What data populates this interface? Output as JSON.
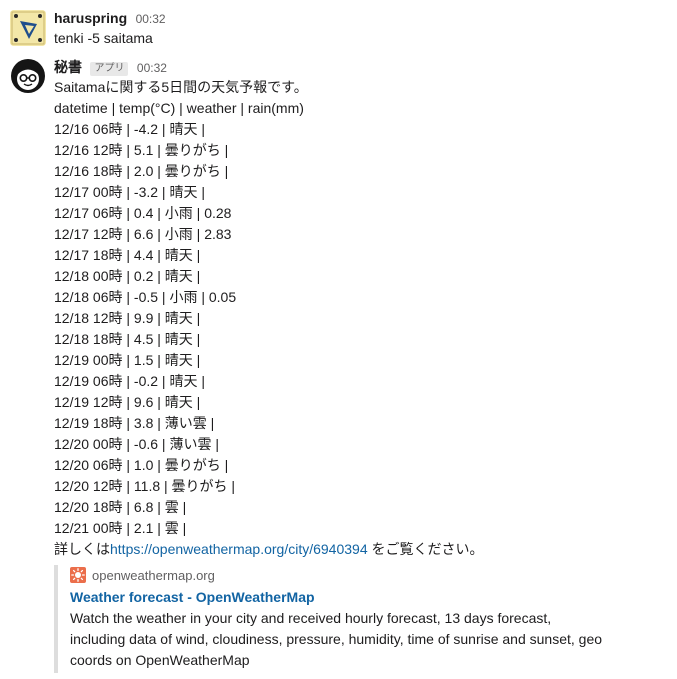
{
  "messages": [
    {
      "user": "haruspring",
      "time": "00:32",
      "lines": [
        "tenki -5 saitama"
      ]
    },
    {
      "user": "秘書",
      "badge": "アプリ",
      "time": "00:32",
      "lines": [
        "Saitamaに関する5日間の天気予報です。",
        "datetime | temp(°C) | weather | rain(mm)",
        "12/16 06時 | -4.2 | 晴天 |",
        "12/16 12時 | 5.1 | 曇りがち |",
        "12/16 18時 | 2.0 | 曇りがち |",
        "12/17 00時 | -3.2 | 晴天 |",
        "12/17 06時 | 0.4 | 小雨 | 0.28",
        "12/17 12時 | 6.6 | 小雨 | 2.83",
        "12/17 18時 | 4.4 | 晴天 |",
        "12/18 00時 | 0.2 | 晴天 |",
        "12/18 06時 | -0.5 | 小雨 | 0.05",
        "12/18 12時 | 9.9 | 晴天 |",
        "12/18 18時 | 4.5 | 晴天 |",
        "12/19 00時 | 1.5 | 晴天 |",
        "12/19 06時 | -0.2 | 晴天 |",
        "12/19 12時 | 9.6 | 晴天 |",
        "12/19 18時 | 3.8 | 薄い雲 |",
        "12/20 00時 | -0.6 | 薄い雲 |",
        "12/20 06時 | 1.0 | 曇りがち |",
        "12/20 12時 | 11.8 | 曇りがち |",
        "12/20 18時 | 6.8 | 雲 |",
        "12/21 00時 | 2.1 | 雲 |"
      ],
      "footer_prefix": "詳しくは",
      "footer_link": "https://openweathermap.org/city/6940394",
      "footer_suffix": " をご覧ください。",
      "attachment": {
        "site": "openweathermap.org",
        "title": "Weather forecast - OpenWeatherMap",
        "description": "Watch the weather in your city and received hourly forecast, 13 days forecast, including data of wind, cloudiness, pressure, humidity, time of sunrise and sunset, geo coords on OpenWeatherMap"
      }
    }
  ],
  "colors": {
    "link": "#1264a3",
    "text": "#1d1c1d",
    "muted": "#616061",
    "site_icon": "#eb6e4b"
  },
  "icons": {
    "avatar1": "compass-logo-icon",
    "avatar2": "face-avatar-icon",
    "site": "sun-icon"
  }
}
